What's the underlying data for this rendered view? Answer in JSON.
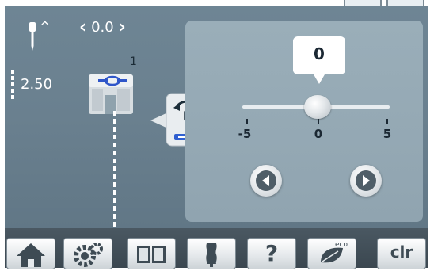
{
  "needle_position": {
    "caret_symbol": "^",
    "offset_value": "0.0",
    "left_chevron": "‹",
    "right_chevron": "›"
  },
  "stitch_length": "2.50",
  "presser_foot": {
    "number": "1"
  },
  "adjust_panel": {
    "current_value": "0",
    "min_label": "-5",
    "mid_label": "0",
    "max_label": "5",
    "slider_value": 0,
    "slider_min": -5,
    "slider_max": 5
  },
  "bottom_bar": {
    "help_label": "?",
    "eco_label": "eco",
    "clear_label": "clr"
  },
  "colors": {
    "screen_bg": "#6a808f",
    "panel_bg": "#95a9b4",
    "bar_bg": "#414e57"
  },
  "icons": [
    "needle-icon",
    "presser-foot-icon",
    "needle-stop-tooltip-icon",
    "arrow-left-icon",
    "arrow-right-icon",
    "home-icon",
    "settings-icon",
    "book-icon",
    "dress-form-icon",
    "help-icon",
    "eco-leaf-icon"
  ]
}
